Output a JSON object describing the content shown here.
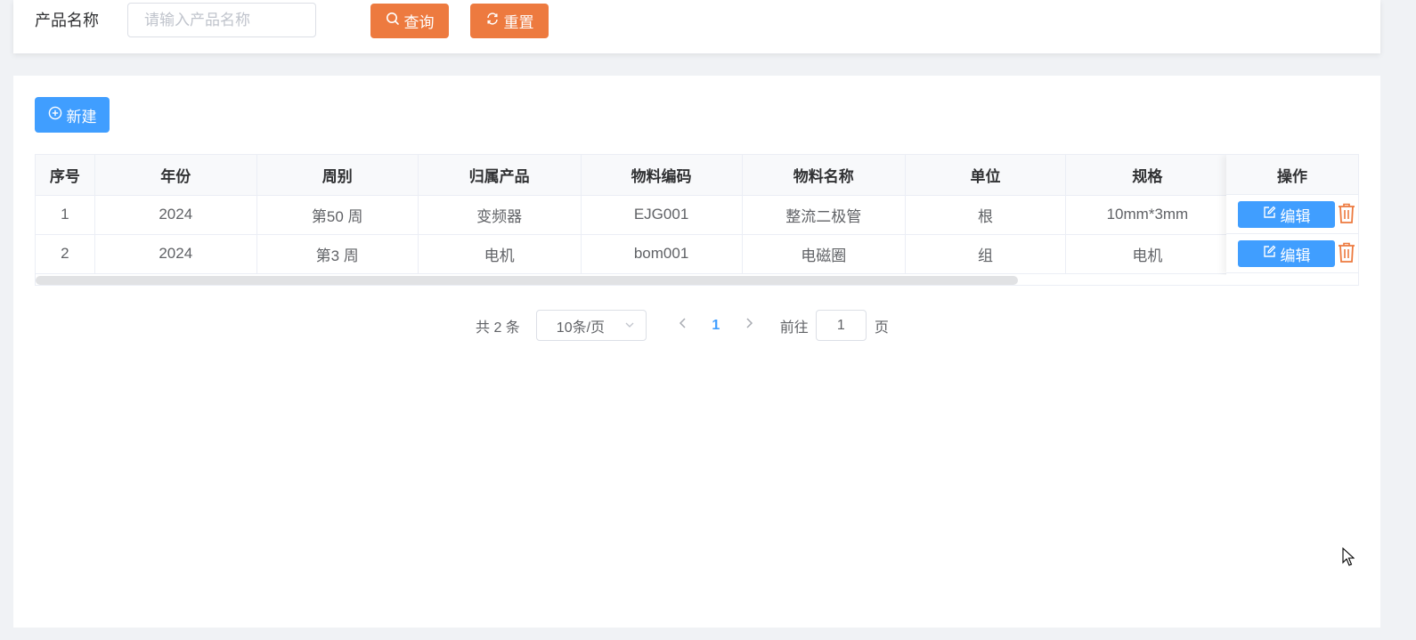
{
  "search": {
    "label": "产品名称",
    "placeholder": "请输入产品名称",
    "value": "",
    "search_label": "查询",
    "reset_label": "重置"
  },
  "toolbar": {
    "new_label": "新建"
  },
  "table": {
    "headers": [
      "序号",
      "年份",
      "周别",
      "归属产品",
      "物料编码",
      "物料名称",
      "单位",
      "规格"
    ],
    "action_header": "操作",
    "rows": [
      [
        "1",
        "2024",
        "第50 周",
        "变频器",
        "EJG001",
        "整流二极管",
        "根",
        "10mm*3mm"
      ],
      [
        "2",
        "2024",
        "第3 周",
        "电机",
        "bom001",
        "电磁圈",
        "组",
        "电机"
      ]
    ],
    "edit_label": "编辑"
  },
  "pagination": {
    "total": "共 2 条",
    "page_size": "10条/页",
    "current_page": "1",
    "goto_prefix": "前往",
    "goto_value": "1",
    "goto_suffix": "页"
  },
  "colors": {
    "primary": "#409eff",
    "orange": "#ed7a3f",
    "delete_icon": "#ed7a3f"
  },
  "icons": {
    "search": "search-icon",
    "reset": "refresh-icon",
    "new": "plus-circle-icon",
    "edit": "edit-icon",
    "delete": "trash-icon"
  }
}
